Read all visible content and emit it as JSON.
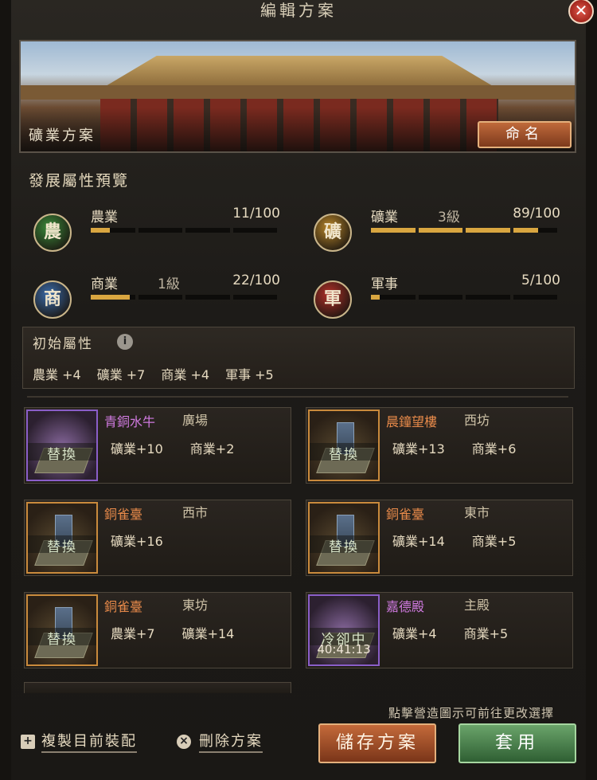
{
  "dialog": {
    "title": "編輯方案",
    "close_label": "✕"
  },
  "banner": {
    "plan_name": "礦業方案",
    "rename_label": "命名"
  },
  "preview": {
    "title": "發展屬性預覽",
    "attributes": [
      {
        "badge": "農",
        "name": "農業",
        "level": "",
        "value": "11/100",
        "progress": 0.11,
        "color": "#3b8a3a"
      },
      {
        "badge": "礦",
        "name": "礦業",
        "level": "3級",
        "value": "89/100",
        "progress": 0.89,
        "color": "#b8862a"
      },
      {
        "badge": "商",
        "name": "商業",
        "level": "1級",
        "value": "22/100",
        "progress": 0.22,
        "color": "#3a6aa8"
      },
      {
        "badge": "軍",
        "name": "軍事",
        "level": "",
        "value": "5/100",
        "progress": 0.05,
        "color": "#b03028"
      }
    ]
  },
  "initial": {
    "title": "初始屬性",
    "info_icon": "i",
    "values": [
      "農業 +4",
      "礦業 +7",
      "商業 +4",
      "軍事 +5"
    ]
  },
  "buildings": [
    {
      "name": "青銅水牛",
      "location": "廣場",
      "stats": [
        "礦業+10",
        "商業+2"
      ],
      "overlay": "替換",
      "cooldown": "",
      "rarity": "purple"
    },
    {
      "name": "晨鐘望樓",
      "location": "西坊",
      "stats": [
        "礦業+13",
        "商業+6"
      ],
      "overlay": "替換",
      "cooldown": "",
      "rarity": "orange"
    },
    {
      "name": "銅雀臺",
      "location": "西市",
      "stats": [
        "礦業+16"
      ],
      "overlay": "替換",
      "cooldown": "",
      "rarity": "orange"
    },
    {
      "name": "銅雀臺",
      "location": "東市",
      "stats": [
        "礦業+14",
        "商業+5"
      ],
      "overlay": "替換",
      "cooldown": "",
      "rarity": "orange"
    },
    {
      "name": "銅雀臺",
      "location": "東坊",
      "stats": [
        "農業+7",
        "礦業+14"
      ],
      "overlay": "替換",
      "cooldown": "",
      "rarity": "orange"
    },
    {
      "name": "嘉德殿",
      "location": "主殿",
      "stats": [
        "礦業+4",
        "商業+5"
      ],
      "overlay": "冷卻中",
      "cooldown": "40:41:13",
      "rarity": "purple"
    }
  ],
  "footer": {
    "hint": "點擊營造圖示可前往更改選擇",
    "copy_label": "複製目前裝配",
    "delete_label": "刪除方案",
    "save_label": "儲存方案",
    "apply_label": "套用"
  }
}
